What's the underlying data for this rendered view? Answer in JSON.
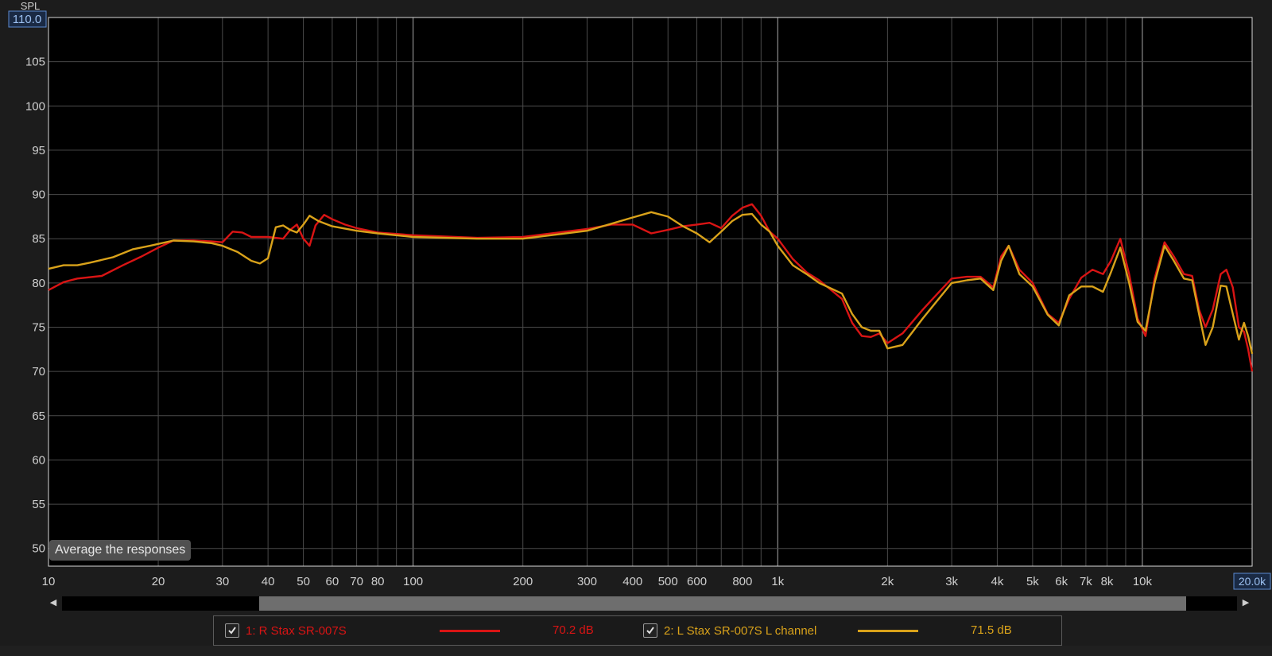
{
  "chart_data": {
    "type": "line",
    "ylabel": "SPL",
    "ylim": [
      48,
      110
    ],
    "xlim": [
      10,
      20000
    ],
    "x_scale": "log",
    "grid": true,
    "top_readout": "110.0",
    "right_readout": "20.0k",
    "y_ticks": [
      50,
      55,
      60,
      65,
      70,
      75,
      80,
      85,
      90,
      95,
      100,
      105
    ],
    "y_tick_labels": [
      "50",
      "55",
      "60",
      "65",
      "70",
      "75",
      "80",
      "85",
      "90",
      "95",
      "100",
      "105"
    ],
    "x_ticks": [
      10,
      20,
      30,
      40,
      50,
      60,
      70,
      80,
      100,
      200,
      300,
      400,
      500,
      600,
      800,
      1000,
      2000,
      3000,
      4000,
      5000,
      6000,
      7000,
      8000,
      10000
    ],
    "x_tick_labels": [
      "10",
      "20",
      "30",
      "40",
      "50",
      "60",
      "70",
      "80",
      "100",
      "200",
      "300",
      "400",
      "500",
      "600",
      "800",
      "1k",
      "2k",
      "3k",
      "4k",
      "5k",
      "6k",
      "7k",
      "8k",
      "10k"
    ],
    "series": [
      {
        "name": "1: R Stax SR-007S",
        "color": "#d91414",
        "points": [
          [
            10,
            79.2
          ],
          [
            11,
            80.1
          ],
          [
            12,
            80.5
          ],
          [
            14,
            80.8
          ],
          [
            16,
            82.0
          ],
          [
            18,
            83.0
          ],
          [
            20,
            84.0
          ],
          [
            22,
            84.8
          ],
          [
            25,
            84.8
          ],
          [
            28,
            84.7
          ],
          [
            30,
            84.6
          ],
          [
            32,
            85.8
          ],
          [
            34,
            85.7
          ],
          [
            36,
            85.2
          ],
          [
            40,
            85.2
          ],
          [
            44,
            85.0
          ],
          [
            46,
            86.0
          ],
          [
            48,
            86.6
          ],
          [
            50,
            85.0
          ],
          [
            52,
            84.2
          ],
          [
            54,
            86.5
          ],
          [
            57,
            87.7
          ],
          [
            60,
            87.2
          ],
          [
            65,
            86.6
          ],
          [
            70,
            86.2
          ],
          [
            80,
            85.7
          ],
          [
            100,
            85.4
          ],
          [
            150,
            85.1
          ],
          [
            200,
            85.2
          ],
          [
            250,
            85.7
          ],
          [
            300,
            86.1
          ],
          [
            350,
            86.6
          ],
          [
            400,
            86.6
          ],
          [
            450,
            85.6
          ],
          [
            500,
            86.0
          ],
          [
            550,
            86.4
          ],
          [
            600,
            86.6
          ],
          [
            650,
            86.8
          ],
          [
            700,
            86.2
          ],
          [
            750,
            87.6
          ],
          [
            800,
            88.5
          ],
          [
            850,
            88.9
          ],
          [
            900,
            87.6
          ],
          [
            950,
            85.8
          ],
          [
            1000,
            85.0
          ],
          [
            1100,
            82.7
          ],
          [
            1200,
            81.2
          ],
          [
            1300,
            80.3
          ],
          [
            1500,
            78.2
          ],
          [
            1600,
            75.5
          ],
          [
            1700,
            74.0
          ],
          [
            1800,
            73.9
          ],
          [
            1900,
            74.3
          ],
          [
            2000,
            73.2
          ],
          [
            2200,
            74.3
          ],
          [
            2500,
            77.0
          ],
          [
            2800,
            79.2
          ],
          [
            3000,
            80.5
          ],
          [
            3300,
            80.7
          ],
          [
            3600,
            80.7
          ],
          [
            3900,
            79.5
          ],
          [
            4100,
            83.0
          ],
          [
            4300,
            84.2
          ],
          [
            4600,
            81.5
          ],
          [
            5000,
            80.0
          ],
          [
            5500,
            76.5
          ],
          [
            5900,
            75.5
          ],
          [
            6300,
            78.2
          ],
          [
            6800,
            80.6
          ],
          [
            7300,
            81.5
          ],
          [
            7800,
            81.0
          ],
          [
            8200,
            82.5
          ],
          [
            8700,
            85.0
          ],
          [
            9200,
            81.0
          ],
          [
            9700,
            76.0
          ],
          [
            10200,
            74.0
          ],
          [
            10800,
            80.5
          ],
          [
            11500,
            84.6
          ],
          [
            12200,
            83.0
          ],
          [
            13000,
            81.0
          ],
          [
            13700,
            80.8
          ],
          [
            14300,
            77.0
          ],
          [
            14900,
            75.0
          ],
          [
            15600,
            77.0
          ],
          [
            16400,
            81.0
          ],
          [
            17000,
            81.5
          ],
          [
            17700,
            79.5
          ],
          [
            18400,
            75.0
          ],
          [
            19000,
            74.5
          ],
          [
            19500,
            72.5
          ],
          [
            20000,
            70.0
          ]
        ]
      },
      {
        "name": "2: L Stax SR-007S L channel",
        "color": "#d9a21a",
        "points": [
          [
            10,
            81.6
          ],
          [
            11,
            82.0
          ],
          [
            12,
            82.0
          ],
          [
            13,
            82.3
          ],
          [
            15,
            82.9
          ],
          [
            17,
            83.8
          ],
          [
            19,
            84.2
          ],
          [
            22,
            84.8
          ],
          [
            25,
            84.7
          ],
          [
            28,
            84.5
          ],
          [
            30,
            84.2
          ],
          [
            33,
            83.5
          ],
          [
            36,
            82.5
          ],
          [
            38,
            82.2
          ],
          [
            40,
            82.8
          ],
          [
            42,
            86.3
          ],
          [
            44,
            86.5
          ],
          [
            46,
            86.0
          ],
          [
            48,
            85.7
          ],
          [
            50,
            86.6
          ],
          [
            52,
            87.6
          ],
          [
            55,
            87.0
          ],
          [
            60,
            86.4
          ],
          [
            70,
            85.9
          ],
          [
            80,
            85.6
          ],
          [
            100,
            85.2
          ],
          [
            150,
            85.0
          ],
          [
            200,
            85.0
          ],
          [
            250,
            85.5
          ],
          [
            300,
            85.9
          ],
          [
            350,
            86.7
          ],
          [
            400,
            87.4
          ],
          [
            450,
            88.0
          ],
          [
            500,
            87.5
          ],
          [
            550,
            86.4
          ],
          [
            600,
            85.6
          ],
          [
            650,
            84.6
          ],
          [
            700,
            85.8
          ],
          [
            750,
            87.0
          ],
          [
            800,
            87.7
          ],
          [
            850,
            87.8
          ],
          [
            900,
            86.6
          ],
          [
            950,
            85.8
          ],
          [
            1000,
            84.2
          ],
          [
            1100,
            82.0
          ],
          [
            1200,
            81.0
          ],
          [
            1300,
            80.0
          ],
          [
            1500,
            78.8
          ],
          [
            1600,
            76.5
          ],
          [
            1700,
            75.0
          ],
          [
            1800,
            74.6
          ],
          [
            1900,
            74.6
          ],
          [
            2000,
            72.6
          ],
          [
            2200,
            73.0
          ],
          [
            2500,
            76.0
          ],
          [
            2800,
            78.5
          ],
          [
            3000,
            80.0
          ],
          [
            3300,
            80.3
          ],
          [
            3600,
            80.5
          ],
          [
            3900,
            79.2
          ],
          [
            4100,
            82.5
          ],
          [
            4300,
            84.2
          ],
          [
            4600,
            81.0
          ],
          [
            5000,
            79.6
          ],
          [
            5500,
            76.4
          ],
          [
            5900,
            75.2
          ],
          [
            6300,
            78.6
          ],
          [
            6800,
            79.6
          ],
          [
            7300,
            79.6
          ],
          [
            7800,
            79.0
          ],
          [
            8200,
            81.2
          ],
          [
            8700,
            84.0
          ],
          [
            9200,
            80.0
          ],
          [
            9700,
            75.6
          ],
          [
            10200,
            74.6
          ],
          [
            10800,
            80.0
          ],
          [
            11500,
            84.2
          ],
          [
            12200,
            82.5
          ],
          [
            13000,
            80.5
          ],
          [
            13700,
            80.3
          ],
          [
            14300,
            76.5
          ],
          [
            14900,
            73.0
          ],
          [
            15600,
            75.0
          ],
          [
            16400,
            79.7
          ],
          [
            17000,
            79.6
          ],
          [
            17700,
            76.5
          ],
          [
            18400,
            73.6
          ],
          [
            19000,
            75.5
          ],
          [
            19500,
            74.0
          ],
          [
            20000,
            72.0
          ]
        ]
      }
    ]
  },
  "legend": {
    "items": [
      {
        "label": "1: R Stax SR-007S",
        "value": "70.2 dB",
        "color": "#d91414"
      },
      {
        "label": "2: L Stax SR-007S L channel",
        "value": "71.5 dB",
        "color": "#d9a21a"
      }
    ]
  },
  "tooltip": {
    "text": "Average the responses"
  },
  "icons": {
    "scroll_left": "chevron-left-icon",
    "scroll_right": "chevron-right-icon",
    "checkbox": "check-icon"
  }
}
